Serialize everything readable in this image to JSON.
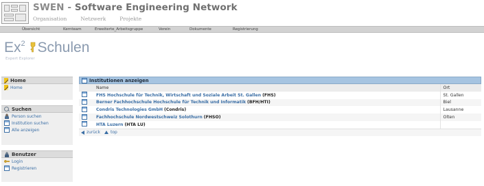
{
  "site": {
    "title_prefix": "SWEN - ",
    "title_brand": "Software Engineering Network",
    "nav": [
      "Organisation",
      "Netzwerk",
      "Projekte"
    ]
  },
  "menubar": [
    "Übersicht",
    "Kernteam",
    "Erweiterte_Arbeitsgruppe",
    "Verein",
    "Dokumente",
    "Registrierung"
  ],
  "app": {
    "logo": "Ex",
    "logo_sup": "2",
    "name": "Schulen",
    "subtitle": "Expert Explorer"
  },
  "sidebar": {
    "home": {
      "title": "Home",
      "items": [
        "Home"
      ]
    },
    "suchen": {
      "title": "Suchen",
      "items": [
        "Person suchen",
        "Institution suchen",
        "Alle anzeigen"
      ]
    },
    "benutzer": {
      "title": "Benutzer",
      "items": [
        "Login",
        "Registrieren"
      ]
    }
  },
  "panel": {
    "title": "Institutionen anzeigen",
    "columns": {
      "name": "Name",
      "ort": "Ort"
    },
    "rows": [
      {
        "name": "FHS Hochschule für Technik, Wirtschaft und Soziale Arbeit St. Gallen",
        "abbr": "(FHS)",
        "ort": "St. Gallen"
      },
      {
        "name": "Berner Fachhochschule Hochschule für Technik und Informatik",
        "abbr": "(BFH/HTI)",
        "ort": "Biel"
      },
      {
        "name": "Condris Technologies GmbH",
        "abbr": "(Condris)",
        "ort": "Lausanne"
      },
      {
        "name": "Fachhochschule Nordwestschweiz Solothurn",
        "abbr": "(FHSO)",
        "ort": "Olten"
      },
      {
        "name": "HTA Luzern",
        "abbr": "(HTA LU)",
        "ort": ""
      }
    ],
    "footer": {
      "back": "zurück",
      "top": "top"
    }
  }
}
